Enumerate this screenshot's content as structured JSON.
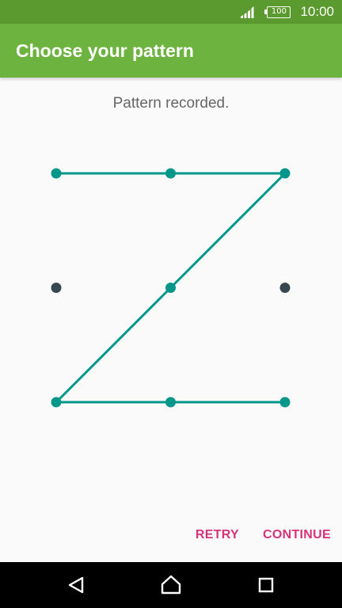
{
  "status_bar": {
    "signal_icon": "cellular-signal-icon",
    "battery_icon": "battery-icon",
    "battery_level": "100",
    "time": "10:00"
  },
  "header": {
    "title": "Choose your pattern"
  },
  "pattern": {
    "message": "Pattern recorded.",
    "grid_size": 3,
    "recorded_sequence": [
      1,
      2,
      3,
      5,
      7,
      8,
      9
    ],
    "active_color": "#00968a",
    "inactive_color": "#37474f"
  },
  "actions": {
    "retry_label": "RETRY",
    "continue_label": "CONTINUE",
    "color": "#d6337a"
  },
  "nav_bar": {
    "back_icon": "back-triangle-icon",
    "home_icon": "home-icon",
    "recents_icon": "recents-square-icon"
  },
  "colors": {
    "status_bar": "#5a9a2e",
    "app_bar": "#6db33f",
    "background": "#fafafa"
  }
}
